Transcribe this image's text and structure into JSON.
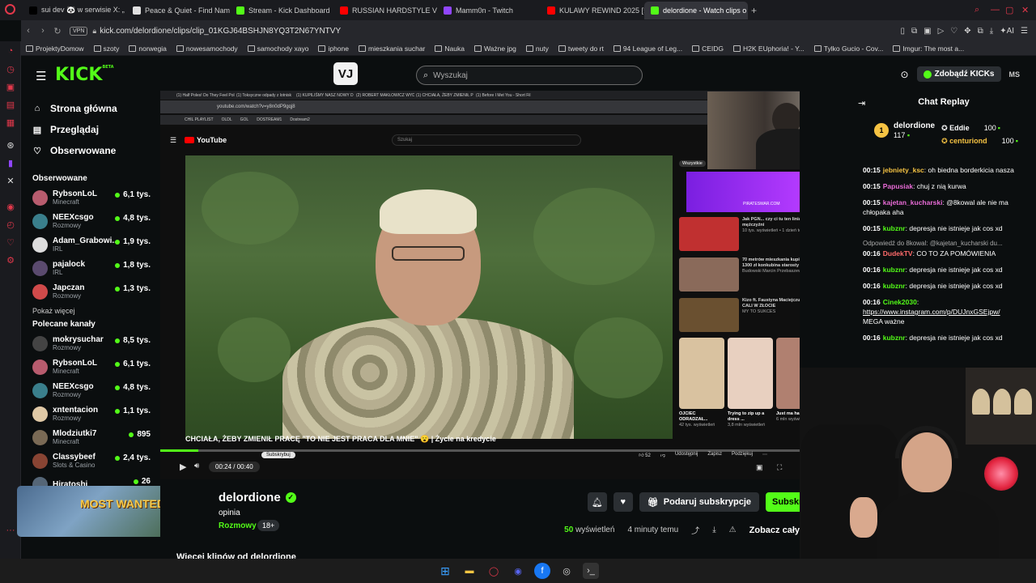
{
  "browser": {
    "tabs": [
      {
        "label": "sui dev 🐼 w serwisie X: „",
        "icon": "x-logo-icon",
        "color": "#000000"
      },
      {
        "label": "Peace & Quiet - Find Nam",
        "icon": "site-icon",
        "color": "#e0e0e0"
      },
      {
        "label": "Stream - Kick Dashboard",
        "icon": "kick-icon",
        "color": "#53fc18"
      },
      {
        "label": "RUSSIAN HARDSTYLE VO",
        "icon": "youtube-icon",
        "color": "#ff0000"
      },
      {
        "label": "Mamm0n - Twitch",
        "icon": "twitch-icon",
        "color": "#9146ff"
      },
      {
        "label": "KULAWY REWIND 2025 [!",
        "icon": "youtube-icon",
        "color": "#ff0000"
      },
      {
        "label": "delordione - Watch clips o",
        "icon": "kick-icon",
        "color": "#53fc18",
        "active": true
      }
    ],
    "new_tab": "+",
    "vpn": "VPN",
    "url": "kick.com/delordione/clips/clip_01KGJ64BSHJN8YQ3T2N67YNTVY",
    "bookmarks": [
      "ProjektyDomow",
      "szoty",
      "norwegia",
      "nowesamochody",
      "samochody xayo",
      "iphone",
      "mieszkania suchar",
      "Nauka",
      "Ważne jpg",
      "nuty",
      "tweety do rt",
      "94 League of Leg...",
      "CEIDG",
      "H2K EUphoria! - Y...",
      "Tylko Gucio - Cov...",
      "Imgur: The most a..."
    ]
  },
  "header": {
    "logo": "KICK",
    "logo_sup": "BETA",
    "extension_label": "VJ",
    "search_placeholder": "Wyszukaj",
    "get_kicks": "Zdobądź KICKs",
    "user_initials": "MS"
  },
  "sidebar": {
    "nav": [
      {
        "label": "Strona główna",
        "icon": "home-icon"
      },
      {
        "label": "Przeglądaj",
        "icon": "browse-icon"
      },
      {
        "label": "Obserwowane",
        "icon": "heart-icon"
      }
    ],
    "following_title": "Obserwowane",
    "following": [
      {
        "name": "RybsonLoL",
        "category": "Minecraft",
        "viewers": "6,1 tys.",
        "color": "#b85c6e"
      },
      {
        "name": "NEEXcsgo",
        "category": "Rozmowy",
        "viewers": "4,8 tys.",
        "color": "#3a7f8c"
      },
      {
        "name": "Adam_Grabowi...",
        "category": "IRL",
        "viewers": "1,9 tys.",
        "color": "#dddddd"
      },
      {
        "name": "pajalock",
        "category": "IRL",
        "viewers": "1,8 tys.",
        "color": "#5a4a6e"
      },
      {
        "name": "Japczan",
        "category": "Rozmowy",
        "viewers": "1,3 tys.",
        "color": "#d04a4a"
      }
    ],
    "show_more": "Pokaż więcej",
    "recommended_title": "Polecane kanały",
    "recommended": [
      {
        "name": "mokrysuchar",
        "category": "Rozmowy",
        "viewers": "8,5 tys.",
        "color": "#444444"
      },
      {
        "name": "RybsonLoL",
        "category": "Minecraft",
        "viewers": "6,1 tys.",
        "color": "#b85c6e"
      },
      {
        "name": "NEEXcsgo",
        "category": "Rozmowy",
        "viewers": "4,8 tys.",
        "color": "#3a7f8c"
      },
      {
        "name": "xntentacion",
        "category": "Rozmowy",
        "viewers": "1,1 tys.",
        "color": "#e0c9a6"
      },
      {
        "name": "Mlodziutki7",
        "category": "Minecraft",
        "viewers": "895",
        "color": "#7a6a55"
      },
      {
        "name": "Classybeef",
        "category": "Slots & Casino",
        "viewers": "2,4 tys.",
        "color": "#884433"
      },
      {
        "name": "Hiratoshi",
        "category": "",
        "viewers": "26",
        "color": "#556677"
      }
    ],
    "promo_text": "MOST WANTED"
  },
  "video": {
    "yt_tabs": [
      "(1) Half Poles! Do They Feel Pol",
      "(1) Toksyczne odpady z lotnisk",
      "(1) KUPILIŚMY NASZ NOWY D",
      "(2) ROBERT MAKŁOWICZ WYD",
      "(1) CHCIAŁA, ŻEBY ZMIENIŁ P",
      "(1) Before I Met You - Short Fil"
    ],
    "yt_url": "youtube.com/watch?v=y8n0dP9gqj8",
    "yt_bookmarks": [
      "CHIL PLAYLIST",
      "OLDL",
      "GOL",
      "DOSTREAM1",
      "Dostream2"
    ],
    "yt_logo": "YouTube",
    "yt_search": "Szukaj",
    "caption": "CHCIAŁA, ŻEBY ZMIENIŁ PRACĘ \"TO NIE JEST PRACA DLA MNIE\" 😮 | Życie na kredycie",
    "time": "00:24 / 00:40",
    "subscribe": "Subskrybuj",
    "likes": "52",
    "share": "Udostępnij",
    "save": "Zapisz",
    "thanks": "Podziękuj",
    "progress": 0.06,
    "side_filter": "Wszystkie",
    "side_items": [
      {
        "title": "Jak PGN... czy ci tu ten liniasz mężczyźni",
        "meta": "10 tys. wyświetleń • 1 dzień temu",
        "color": "#c03030"
      },
      {
        "title": "70 metrów mieszkania kupiła za 1300 zł konkubina starosty",
        "meta": "Budowski Marcin Przebaszewski",
        "color": "#8a6a5a"
      },
      {
        "title": "Kizo ft. Faustyna Maciejczuk - CALI W ZŁOCIE",
        "meta": "MY TO SUKCES",
        "color": "#6a5030"
      }
    ],
    "shorts": [
      {
        "title": "OJCIEC ODRADZAŁ...",
        "views": "42 tys. wyświetleń"
      },
      {
        "title": "Trying to zip up a dress ...",
        "views": "3,8 mln wyświetleń"
      },
      {
        "title": "Just ma have to ...",
        "views": "6 mln wyświetleń"
      }
    ],
    "promo_site": "PIRATESWAR.COM"
  },
  "clip_info": {
    "streamer": "delordione",
    "title": "opinia",
    "category": "Rozmowy",
    "age_tag": "18+",
    "gift_label": "Podaruj subskrypcje",
    "subscribe_label": "Subskrybuj",
    "views_count": "50",
    "views_label": "wyświetleń",
    "time_ago": "4 minuty temu",
    "see_all": "Zobacz cały",
    "more_clips": "Więcej klipów od delordione"
  },
  "chat": {
    "title": "Chat Replay",
    "leader": {
      "rank": "1",
      "name": "delordione",
      "amount": "117"
    },
    "others": [
      {
        "name": "Eddie",
        "amount": "100",
        "color": "#ffffff"
      },
      {
        "name": "centuriond",
        "amount": "100",
        "color": "#f6c343"
      }
    ],
    "messages": [
      {
        "time": "00:15",
        "user": "jebniety_ksc",
        "color": "#f6c343",
        "text": "oh biedna borderkicia nasza"
      },
      {
        "time": "00:15",
        "user": "Papusiak",
        "color": "#e86bd6",
        "text": "chuj z nią kurwa"
      },
      {
        "time": "00:15",
        "user": "kajetan_kucharski",
        "color": "#e86bd6",
        "text": "@8kowal ale nie ma chłopaka aha"
      },
      {
        "time": "00:15",
        "user": "kubznr",
        "color": "#53fc18",
        "text": "depresja nie istnieje jak cos xd"
      },
      {
        "time": "00:16",
        "user": "DudekTV",
        "color": "#ff6b6b",
        "text": "CO TO ZA POMÓWIENIA",
        "reply": "Odpowiedź do 8kowal: @kajetan_kucharski du..."
      },
      {
        "time": "00:16",
        "user": "kubznr",
        "color": "#53fc18",
        "text": "depresja nie istnieje jak cos xd"
      },
      {
        "time": "00:16",
        "user": "kubznr",
        "color": "#53fc18",
        "text": "depresja nie istnieje jak cos xd"
      },
      {
        "time": "00:16",
        "user": "Cinek2030",
        "color": "#53fc18",
        "text": "MEGA ważne",
        "link": "https://www.instagram.com/p/DUJnxGSEjpw/"
      },
      {
        "time": "00:16",
        "user": "kubznr",
        "color": "#53fc18",
        "text": "depresja nie istnieje jak cos xd"
      }
    ]
  },
  "taskbar": {
    "icons": [
      "windows-icon",
      "folder-icon",
      "opera-icon",
      "discord-icon",
      "facebook-icon",
      "obs-icon",
      "terminal-icon"
    ]
  },
  "colors": {
    "accent": "#53fc18",
    "background": "#0b0e0f",
    "panel": "#2b2f33"
  }
}
